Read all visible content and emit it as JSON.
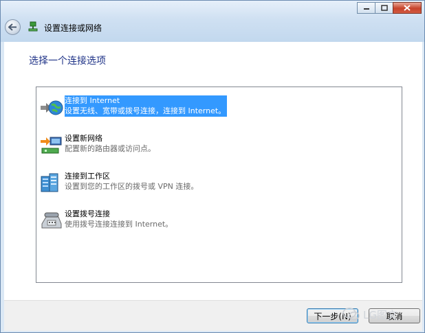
{
  "window": {
    "title": "设置连接或网络",
    "caption_icons": [
      "minimize-icon",
      "maximize-icon",
      "close-icon"
    ]
  },
  "heading": "选择一个连接选项",
  "options": [
    {
      "title": "连接到 Internet",
      "description": "设置无线、宽带或拨号连接，连接到 Internet。",
      "icon": "globe-internet-icon",
      "selected": true
    },
    {
      "title": "设置新网络",
      "description": "配置新的路由器或访问点。",
      "icon": "new-network-icon",
      "selected": false
    },
    {
      "title": "连接到工作区",
      "description": "设置到您的工作区的拨号或 VPN 连接。",
      "icon": "workplace-icon",
      "selected": false
    },
    {
      "title": "设置拨号连接",
      "description": "使用拨号连接连接到 Internet。",
      "icon": "dialup-phone-icon",
      "selected": false
    }
  ],
  "buttons": {
    "next": "下一步(N)",
    "cancel": "取消"
  },
  "watermark": "LG图文",
  "colors": {
    "selection": "#3399ff",
    "heading": "#1e3287"
  }
}
